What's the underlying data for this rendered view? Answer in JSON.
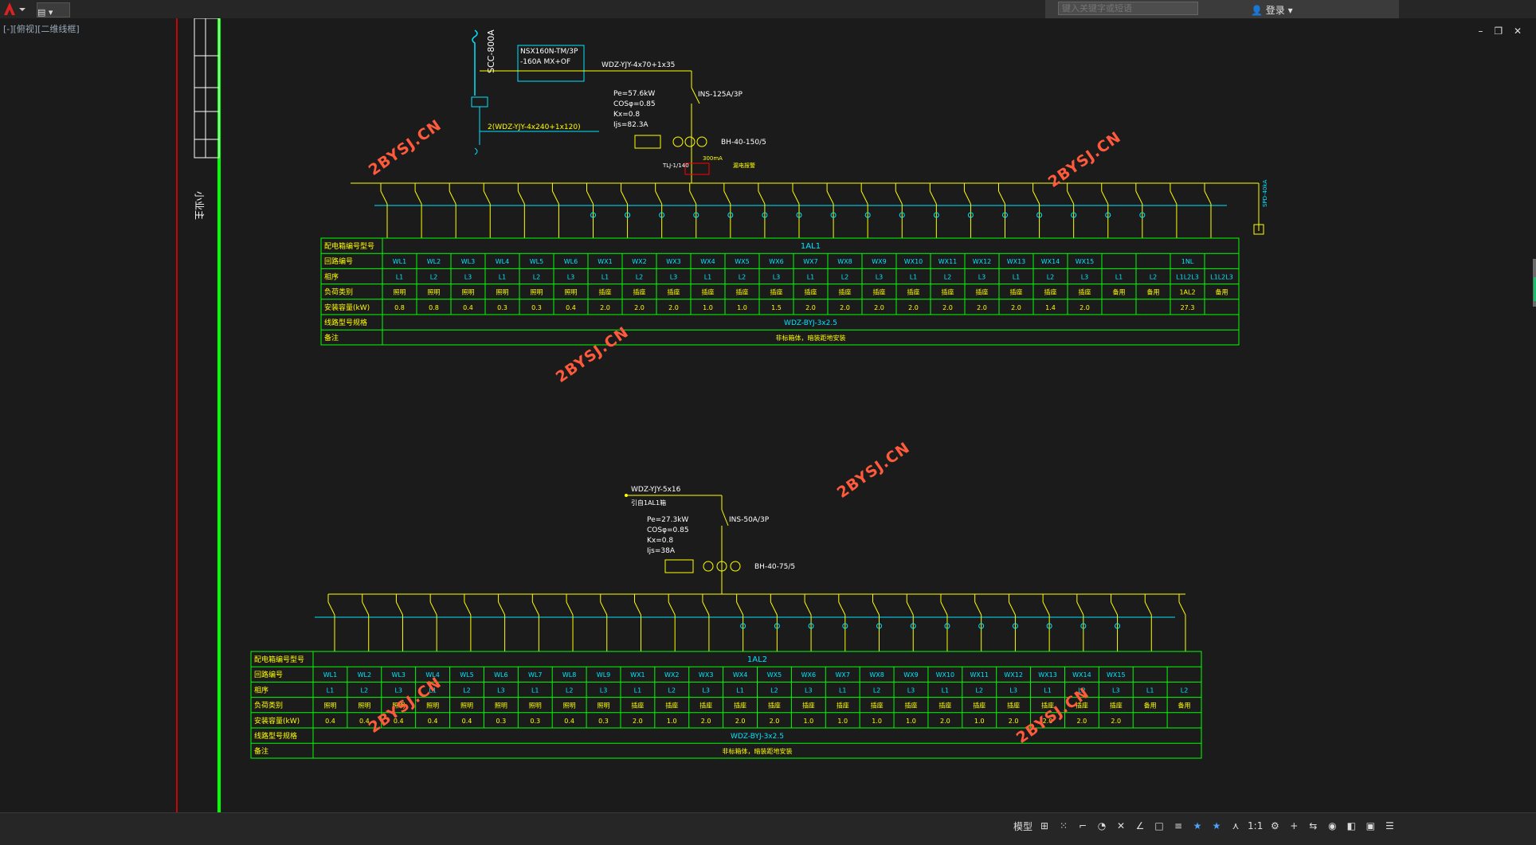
{
  "app": {
    "menu_button_icon": "autocad-logo-icon",
    "viewport_label": "[-][俯视][二维线框]",
    "search_placeholder": "键入关键字或短语",
    "login_label": "登录",
    "window_controls": [
      "–",
      "❐",
      "✕"
    ]
  },
  "watermarks": [
    "2BYSJ.CN",
    "2BYSJ.CN",
    "2BYSJ.CN",
    "2BYSJ.CN",
    "2BYSJ.CN",
    "2BYSJ.CN"
  ],
  "title_block_text": "小业主",
  "panel1": {
    "incoming_cable": "WDZ-YJY-4x70+1x35",
    "supply_label": "SCC-800A",
    "main_breaker": [
      "NSX160N-TM/3P",
      "-160A  MX+OF"
    ],
    "switch": "INS-125A/3P",
    "feeder2": "2(WDZ-YJY-4x240+1x120)",
    "calc": [
      "Pe=57.6kW",
      "COSφ=0.85",
      "Kx=0.8",
      "Ijs=82.3A"
    ],
    "ct": "BH-40-150/5",
    "rcd": "300mA",
    "rcd_note": "漏电报警",
    "grounding": "TLJ-1/140",
    "surge": "SPD-40kA",
    "table": {
      "rows": [
        "配电箱编号型号",
        "回路编号",
        "相序",
        "负荷类别",
        "安装容量(kW)",
        "线路型号规格",
        "备注"
      ],
      "panel_id": "1AL1",
      "circuits": [
        "WL1",
        "WL2",
        "WL3",
        "WL4",
        "WL5",
        "WL6",
        "WX1",
        "WX2",
        "WX3",
        "WX4",
        "WX5",
        "WX6",
        "WX7",
        "WX8",
        "WX9",
        "WX10",
        "WX11",
        "WX12",
        "WX13",
        "WX14",
        "WX15",
        "",
        "",
        "1NL",
        ""
      ],
      "phases": [
        "L1",
        "L2",
        "L3",
        "L1",
        "L2",
        "L3",
        "L1",
        "L2",
        "L3",
        "L1",
        "L2",
        "L3",
        "L1",
        "L2",
        "L3",
        "L1",
        "L2",
        "L3",
        "L1",
        "L2",
        "L3",
        "L1",
        "L2",
        "L1L2L3",
        "L1L2L3"
      ],
      "loads": [
        "照明",
        "照明",
        "照明",
        "照明",
        "照明",
        "照明",
        "插座",
        "插座",
        "插座",
        "插座",
        "插座",
        "插座",
        "插座",
        "插座",
        "插座",
        "插座",
        "插座",
        "插座",
        "插座",
        "插座",
        "插座",
        "备用",
        "备用",
        "1AL2",
        "备用"
      ],
      "kw": [
        "0.8",
        "0.8",
        "0.4",
        "0.3",
        "0.3",
        "0.4",
        "2.0",
        "2.0",
        "2.0",
        "1.0",
        "1.0",
        "1.5",
        "2.0",
        "2.0",
        "2.0",
        "2.0",
        "2.0",
        "2.0",
        "2.0",
        "1.4",
        "2.0",
        "",
        "",
        "27.3",
        ""
      ],
      "wire": "WDZ-BYJ-3x2.5",
      "note": "非标箱体，暗装距地安装"
    }
  },
  "panel2": {
    "incoming_cable": "WDZ-YJY-5x16",
    "incoming_from": "引自1AL1箱",
    "switch": "INS-50A/3P",
    "calc": [
      "Pe=27.3kW",
      "COSφ=0.85",
      "Kx=0.8",
      "Ijs=38A"
    ],
    "ct": "BH-40-75/5",
    "table": {
      "rows": [
        "配电箱编号型号",
        "回路编号",
        "相序",
        "负荷类别",
        "安装容量(kW)",
        "线路型号规格",
        "备注"
      ],
      "panel_id": "1AL2",
      "circuits": [
        "WL1",
        "WL2",
        "WL3",
        "WL4",
        "WL5",
        "WL6",
        "WL7",
        "WL8",
        "WL9",
        "WX1",
        "WX2",
        "WX3",
        "WX4",
        "WX5",
        "WX6",
        "WX7",
        "WX8",
        "WX9",
        "WX10",
        "WX11",
        "WX12",
        "WX13",
        "WX14",
        "WX15",
        "",
        ""
      ],
      "phases": [
        "L1",
        "L2",
        "L3",
        "L1",
        "L2",
        "L3",
        "L1",
        "L2",
        "L3",
        "L1",
        "L2",
        "L3",
        "L1",
        "L2",
        "L3",
        "L1",
        "L2",
        "L3",
        "L1",
        "L2",
        "L3",
        "L1",
        "L2",
        "L3",
        "L1",
        "L2"
      ],
      "loads": [
        "照明",
        "照明",
        "照明",
        "照明",
        "照明",
        "照明",
        "照明",
        "照明",
        "照明",
        "插座",
        "插座",
        "插座",
        "插座",
        "插座",
        "插座",
        "插座",
        "插座",
        "插座",
        "插座",
        "插座",
        "插座",
        "插座",
        "插座",
        "插座",
        "备用",
        "备用"
      ],
      "kw": [
        "0.4",
        "0.4",
        "0.4",
        "0.4",
        "0.4",
        "0.3",
        "0.3",
        "0.4",
        "0.3",
        "2.0",
        "1.0",
        "2.0",
        "2.0",
        "2.0",
        "1.0",
        "1.0",
        "1.0",
        "1.0",
        "2.0",
        "1.0",
        "2.0",
        "2.0",
        "2.0",
        "2.0",
        "",
        ""
      ],
      "wire": "WDZ-BYJ-3x2.5",
      "note": "非标箱体，暗装距地安装"
    }
  },
  "status": {
    "buttons": [
      "模型",
      "⊞",
      "⁙",
      "⌐",
      "◔",
      "✕",
      "∠",
      "□",
      "≡",
      "★",
      "★",
      "⋏",
      "1:1",
      "⚙",
      "+",
      "⇆",
      "◉",
      "◧",
      "▣",
      "☰"
    ]
  },
  "colors": {
    "cad_bg": "#1b1b1b",
    "cyan": "#00e5ff",
    "yellow": "#ffff00",
    "green": "#00ff00",
    "red": "#ff0000",
    "watermark": "#ff5a3c"
  }
}
